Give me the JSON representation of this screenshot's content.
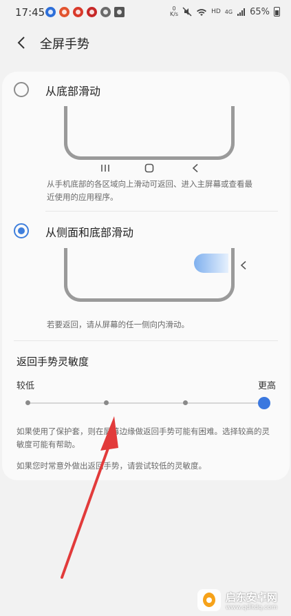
{
  "status_bar": {
    "time": "17:45",
    "network_speed": "0\nK/s",
    "hd_label": "HD",
    "signal_label": "4G",
    "battery": "65%",
    "notif_colors": [
      "#2e6fd9",
      "#e2542f",
      "#d93a2b",
      "#c62828",
      "#6b6b6b",
      "#555555"
    ]
  },
  "header": {
    "title": "全屏手势"
  },
  "options": [
    {
      "label": "从底部滑动",
      "selected": false,
      "description": "从手机底部的各区域向上滑动可返回、进入主屏幕或查看最近使用的应用程序。",
      "nav_icons": [
        "recents-icon",
        "home-icon",
        "back-icon"
      ]
    },
    {
      "label": "从侧面和底部滑动",
      "selected": true,
      "description": "若要返回，请从屏幕的任一侧向内滑动。"
    }
  ],
  "sensitivity": {
    "title": "返回手势灵敏度",
    "min_label": "较低",
    "max_label": "更高",
    "levels": 4,
    "value_index": 3,
    "note_1": "如果使用了保护套，则在屏幕边缘做返回手势可能有困难。选择较高的灵敏度可能有帮助。",
    "note_2": "如果您时常意外做出返回手势，请尝试较低的灵敏度。"
  },
  "watermark": {
    "title": "启东安卓网",
    "url": "www.qdltdq.com"
  },
  "colors": {
    "accent": "#3b78df",
    "annotation": "#e23b3b"
  }
}
